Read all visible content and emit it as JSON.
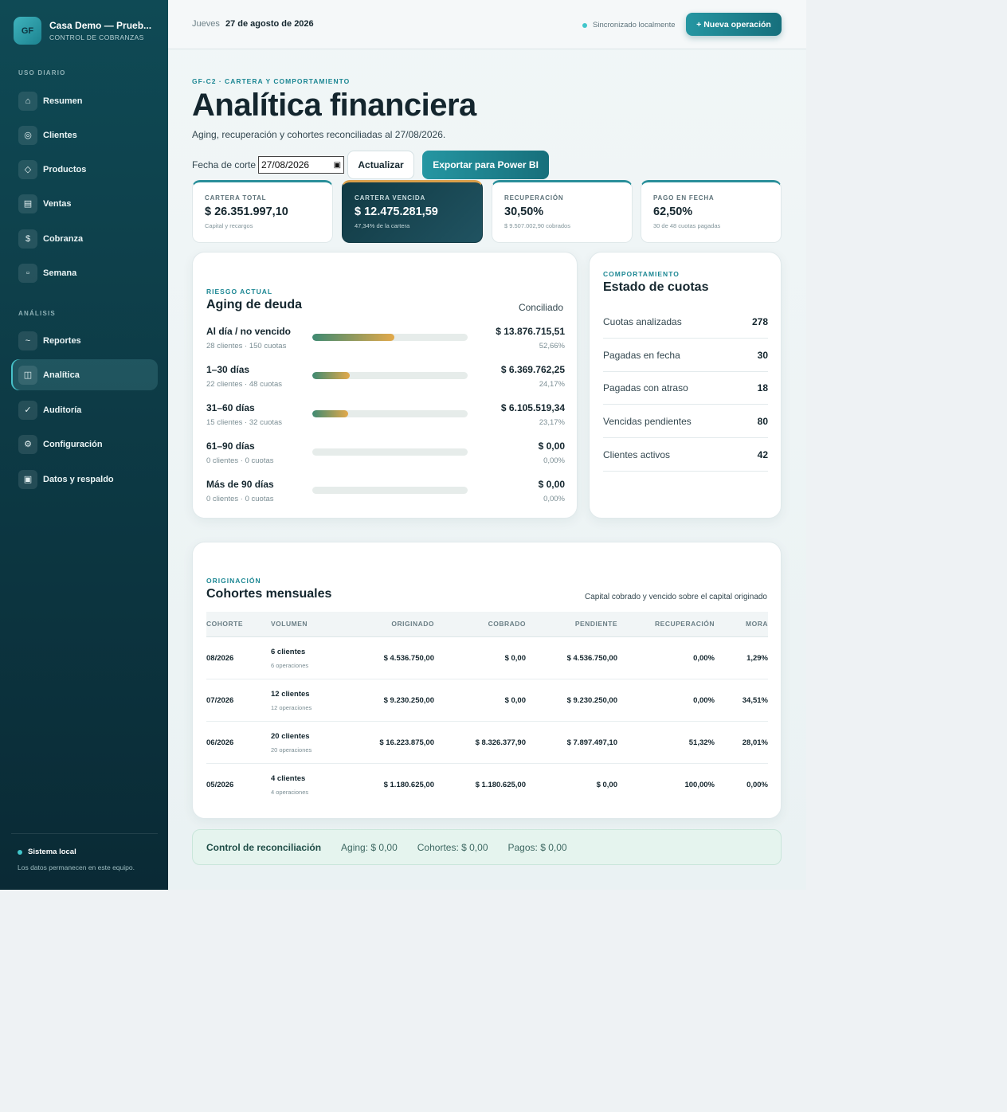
{
  "brand": {
    "logo": "GF",
    "name": "Casa Demo — Prueb...",
    "sub": "CONTROL DE COBRANZAS"
  },
  "nav": {
    "section1": "USO DIARIO",
    "section2": "ANÁLISIS",
    "items": [
      {
        "label": "Resumen",
        "icon": "⌂",
        "icon_name": "home-icon"
      },
      {
        "label": "Clientes",
        "icon": "◎",
        "icon_name": "users-icon"
      },
      {
        "label": "Productos",
        "icon": "◇",
        "icon_name": "box-icon"
      },
      {
        "label": "Ventas",
        "icon": "▤",
        "icon_name": "receipt-icon"
      },
      {
        "label": "Cobranza",
        "icon": "$",
        "icon_name": "dollar-icon"
      },
      {
        "label": "Semana",
        "icon": "▫",
        "icon_name": "calendar-icon"
      },
      {
        "label": "Reportes",
        "icon": "~",
        "icon_name": "chart-line-icon"
      },
      {
        "label": "Analítica",
        "icon": "◫",
        "icon_name": "analytics-icon"
      },
      {
        "label": "Auditoría",
        "icon": "✓",
        "icon_name": "check-icon"
      },
      {
        "label": "Configuración",
        "icon": "⚙",
        "icon_name": "gear-icon"
      },
      {
        "label": "Datos y respaldo",
        "icon": "▣",
        "icon_name": "database-icon"
      }
    ],
    "active": "Analítica"
  },
  "footer": {
    "title": "Sistema local",
    "sub": "Los datos permanecen en este equipo."
  },
  "topbar": {
    "day": "Jueves",
    "date": "27 de agosto de 2026",
    "sync": "Sincronizado localmente",
    "new_button": "+ Nueva operación"
  },
  "page": {
    "eyebrow": "GF-C2 · CARTERA Y COMPORTAMIENTO",
    "title": "Analítica financiera",
    "subtitle": "Aging, recuperación y cohortes reconciliadas al 27/08/2026.",
    "date_label": "Fecha de corte",
    "date_value": "27/08/2026",
    "update_button": "Actualizar",
    "export_button": "Exportar para Power BI"
  },
  "kpis": [
    {
      "label": "CARTERA TOTAL",
      "value": "$ 26.351.997,10",
      "sub": "Capital y recargos"
    },
    {
      "label": "CARTERA VENCIDA",
      "value": "$ 12.475.281,59",
      "sub": "47,34% de la cartera"
    },
    {
      "label": "RECUPERACIÓN",
      "value": "30,50%",
      "sub": "$ 9.507.002,90 cobrados"
    },
    {
      "label": "PAGO EN FECHA",
      "value": "62,50%",
      "sub": "30 de 48 cuotas pagadas"
    }
  ],
  "aging": {
    "eyebrow": "RIESGO ACTUAL",
    "title": "Aging de deuda",
    "badge": "Conciliado",
    "rows": [
      {
        "label": "Al día / no vencido",
        "sub": "28 clientes · 150 cuotas",
        "amount": "$ 13.876.715,51",
        "pct": "52,66%",
        "fraction": 0.5266
      },
      {
        "label": "1–30 días",
        "sub": "22 clientes · 48 cuotas",
        "amount": "$ 6.369.762,25",
        "pct": "24,17%",
        "fraction": 0.2417
      },
      {
        "label": "31–60 días",
        "sub": "15 clientes · 32 cuotas",
        "amount": "$ 6.105.519,34",
        "pct": "23,17%",
        "fraction": 0.2317
      },
      {
        "label": "61–90 días",
        "sub": "0 clientes · 0 cuotas",
        "amount": "$ 0,00",
        "pct": "0,00%",
        "fraction": 0
      },
      {
        "label": "Más de 90 días",
        "sub": "0 clientes · 0 cuotas",
        "amount": "$ 0,00",
        "pct": "0,00%",
        "fraction": 0
      }
    ]
  },
  "state": {
    "eyebrow": "COMPORTAMIENTO",
    "title": "Estado de cuotas",
    "rows": [
      {
        "label": "Cuotas analizadas",
        "value": "278"
      },
      {
        "label": "Pagadas en fecha",
        "value": "30"
      },
      {
        "label": "Pagadas con atraso",
        "value": "18"
      },
      {
        "label": "Vencidas pendientes",
        "value": "80"
      },
      {
        "label": "Clientes activos",
        "value": "42"
      }
    ]
  },
  "cohorts": {
    "eyebrow": "ORIGINACIÓN",
    "title": "Cohortes mensuales",
    "note": "Capital cobrado y vencido sobre el capital originado",
    "headers": [
      "COHORTE",
      "VOLUMEN",
      "ORIGINADO",
      "COBRADO",
      "PENDIENTE",
      "RECUPERACIÓN",
      "MORA"
    ],
    "rows": [
      {
        "cohort": "08/2026",
        "clients": "6 clientes",
        "ops": "6 operaciones",
        "originated": "$ 4.536.750,00",
        "collected": "$ 0,00",
        "pending": "$ 4.536.750,00",
        "recovery": "0,00%",
        "delinquency": "1,29%"
      },
      {
        "cohort": "07/2026",
        "clients": "12 clientes",
        "ops": "12 operaciones",
        "originated": "$ 9.230.250,00",
        "collected": "$ 0,00",
        "pending": "$ 9.230.250,00",
        "recovery": "0,00%",
        "delinquency": "34,51%"
      },
      {
        "cohort": "06/2026",
        "clients": "20 clientes",
        "ops": "20 operaciones",
        "originated": "$ 16.223.875,00",
        "collected": "$ 8.326.377,90",
        "pending": "$ 7.897.497,10",
        "recovery": "51,32%",
        "delinquency": "28,01%"
      },
      {
        "cohort": "05/2026",
        "clients": "4 clientes",
        "ops": "4 operaciones",
        "originated": "$ 1.180.625,00",
        "collected": "$ 1.180.625,00",
        "pending": "$ 0,00",
        "recovery": "100,00%",
        "delinquency": "0,00%"
      }
    ]
  },
  "recon": {
    "title": "Control de reconciliación",
    "aging": "Aging: $ 0,00",
    "cohorts": "Cohortes: $ 0,00",
    "payments": "Pagos: $ 0,00"
  }
}
